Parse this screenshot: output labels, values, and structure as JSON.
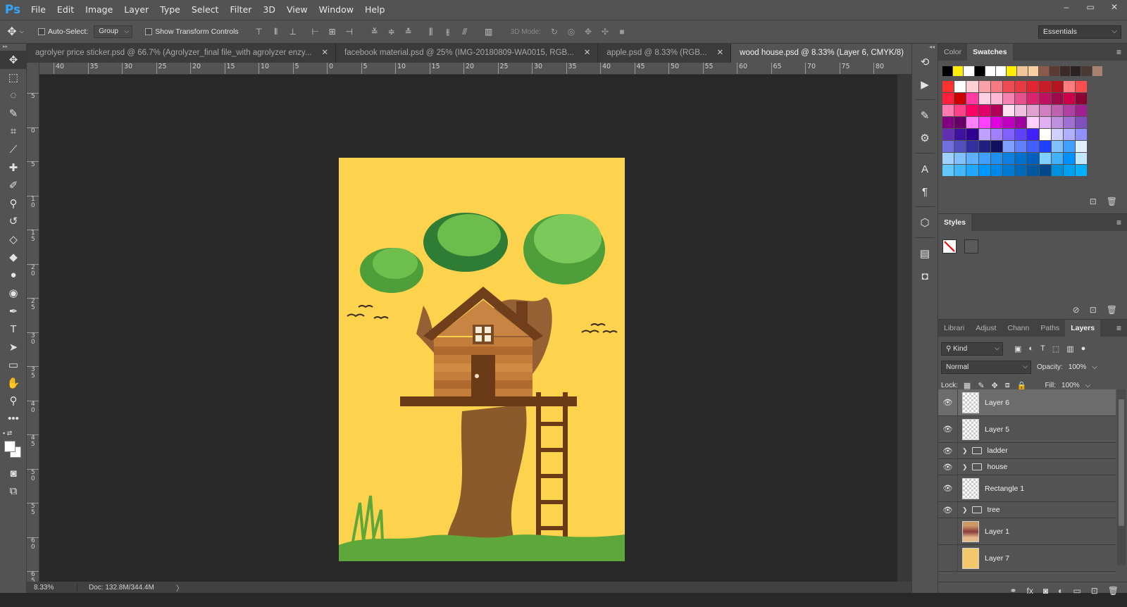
{
  "app": {
    "logo": "Ps"
  },
  "menu": [
    "File",
    "Edit",
    "Image",
    "Layer",
    "Type",
    "Select",
    "Filter",
    "3D",
    "View",
    "Window",
    "Help"
  ],
  "window_controls": [
    "–",
    "▭",
    "✕"
  ],
  "options": {
    "auto_select_label": "Auto-Select:",
    "auto_select_value": "Group",
    "transform_label": "Show Transform Controls",
    "mode_3d_label": "3D Mode:",
    "workspace": "Essentials"
  },
  "tabs": [
    {
      "label": "agrolyer price sticker.psd @ 66.7% (Agrolyzer_final file_with agrolyzer enzy...",
      "close": "✕"
    },
    {
      "label": "facebook material.psd @ 25% (IMG-20180809-WA0015, RGB...",
      "close": "✕"
    },
    {
      "label": "apple.psd @ 8.33% (RGB...",
      "close": "✕"
    },
    {
      "label": "wood house.psd @ 8.33% (Layer 6, CMYK/8)",
      "close": "✕"
    }
  ],
  "ruler_top": [
    "40",
    "35",
    "30",
    "25",
    "20",
    "15",
    "10",
    "5",
    "0",
    "5",
    "10",
    "15",
    "20",
    "25",
    "30",
    "35",
    "40",
    "45",
    "50",
    "55",
    "60",
    "65",
    "70",
    "75",
    "80"
  ],
  "ruler_left": [
    "5",
    "0",
    "5",
    "1 0",
    "1 5",
    "2 0",
    "2 5",
    "3 0",
    "3 5",
    "4 0",
    "4 5",
    "5 0",
    "5 5",
    "6 0",
    "6 5"
  ],
  "status": {
    "zoom": "8.33%",
    "doc": "Doc: 132.8M/344.4M",
    "arrow": "〉"
  },
  "panels": {
    "color_tab": "Color",
    "swatches_tab": "Swatches",
    "styles_tab": "Styles",
    "layer_tabs": [
      "Librari",
      "Adjust",
      "Chann",
      "Paths",
      "Layers"
    ],
    "kind": "Kind",
    "blend_mode": "Normal",
    "opacity_label": "Opacity:",
    "opacity_value": "100%",
    "lock_label": "Lock:",
    "fill_label": "Fill:",
    "fill_value": "100%"
  },
  "swatch_top": [
    "#000000",
    "#ffee00",
    "#ffffff",
    "#000000",
    "#ffffff",
    "#ffffff",
    "#ffee00",
    "#f2c49a",
    "#f7cfa0",
    "#8b5a4a",
    "#5a3a32",
    "#3a2a28",
    "#2a2424",
    "#4a3a36",
    "#a7826e"
  ],
  "swatch_rows": [
    [
      "#ff3030",
      "#ffffff",
      "#ffcfd6",
      "#f7a1a8",
      "#f57a82",
      "#ee4b55",
      "#e83a43",
      "#e02631",
      "#c81d28",
      "#b41620",
      "#ff7d7d",
      "#ff4e4e"
    ],
    [
      "#ff1e3c",
      "#cc0000",
      "#ff3aa0",
      "#ffd0e4",
      "#ffb8d4",
      "#f582b0",
      "#e8508c",
      "#d9246f",
      "#c01060",
      "#a0084c",
      "#cc0047",
      "#8c0033"
    ],
    [
      "#ff7ab0",
      "#ff4089",
      "#ff0066",
      "#e0006a",
      "#b20059",
      "#ffe0f0",
      "#f0c0e0",
      "#e0a0d0",
      "#d080c0",
      "#c060b0",
      "#b040a0",
      "#a02090"
    ],
    [
      "#800080",
      "#660066",
      "#ff80ff",
      "#ff40ff",
      "#e000e0",
      "#c000c0",
      "#a000a0",
      "#ffd0ff",
      "#e0b0f0",
      "#c090e0",
      "#a070d0",
      "#8050c0"
    ],
    [
      "#6030b0",
      "#4010a0",
      "#300090",
      "#c0a0ff",
      "#a080ff",
      "#8060ff",
      "#6040ff",
      "#4020ff",
      "#ffffff",
      "#d0d0ff",
      "#b0b0ff",
      "#9090ff"
    ],
    [
      "#7070e0",
      "#5050c0",
      "#3030a0",
      "#202080",
      "#101060",
      "#80a0ff",
      "#6080ff",
      "#4060ff",
      "#2040ff",
      "#80c0ff",
      "#40a0ff",
      "#e0f0ff"
    ],
    [
      "#a0d0ff",
      "#80c0ff",
      "#60b0ff",
      "#40a0ff",
      "#2090f0",
      "#1080e0",
      "#0070d0",
      "#0060c0",
      "#80d0ff",
      "#40b0ff",
      "#0090ff",
      "#c0e8ff"
    ],
    [
      "#60c8ff",
      "#40b8ff",
      "#20a8ff",
      "#0098ff",
      "#0088e8",
      "#0078d0",
      "#0068b8",
      "#0058a0",
      "#004888",
      "#0090e0",
      "#00a0f0",
      "#00b0ff"
    ]
  ],
  "layers": [
    {
      "name": "Layer 6",
      "type": "layer",
      "visible": true,
      "selected": true
    },
    {
      "name": "Layer 5",
      "type": "layer",
      "visible": true,
      "selected": false
    },
    {
      "name": "ladder",
      "type": "group",
      "visible": true,
      "selected": false
    },
    {
      "name": "house",
      "type": "group",
      "visible": true,
      "selected": false
    },
    {
      "name": "Rectangle 1",
      "type": "shape",
      "visible": true,
      "selected": false
    },
    {
      "name": "tree",
      "type": "group",
      "visible": true,
      "selected": false
    },
    {
      "name": "Layer 1",
      "type": "photo",
      "visible": false,
      "selected": false
    },
    {
      "name": "Layer 7",
      "type": "yellow",
      "visible": false,
      "selected": false
    }
  ],
  "colors": {
    "artboard": "#fdd34d",
    "ps_blue": "#31a8ff"
  }
}
